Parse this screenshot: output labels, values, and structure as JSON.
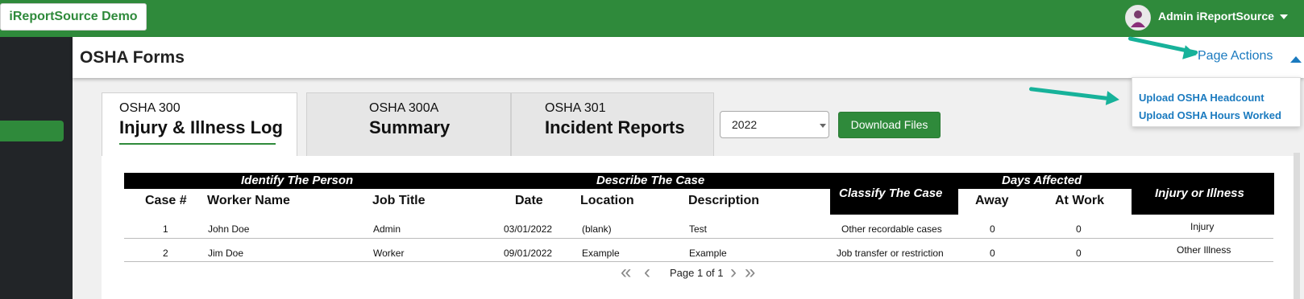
{
  "topbar": {
    "brand": "iReportSource Demo",
    "user_name": "Admin iReportSource"
  },
  "header": {
    "title": "OSHA Forms",
    "page_actions": "Page Actions"
  },
  "page_actions_menu": [
    "Upload OSHA Headcount",
    "Upload OSHA Hours Worked"
  ],
  "tabs": [
    {
      "code": "OSHA 300",
      "title": "Injury & Illness Log"
    },
    {
      "code": "OSHA 300A",
      "title": "Summary"
    },
    {
      "code": "OSHA 301",
      "title": "Incident Reports"
    }
  ],
  "year_select": {
    "value": "2022"
  },
  "download_button": "Download Files",
  "table": {
    "groups": {
      "identify": "Identify The Person",
      "describe": "Describe The Case",
      "classify": "Classify The Case",
      "days": "Days Affected",
      "injury": "Injury or Illness"
    },
    "columns": [
      "Case #",
      "Worker Name",
      "Job Title",
      "Date",
      "Location",
      "Description",
      "Away",
      "At Work"
    ],
    "rows": [
      {
        "case": "1",
        "worker": "John Doe",
        "job": "Admin",
        "date": "03/01/2022",
        "location": "(blank)",
        "description": "Test",
        "classify": "Other recordable cases",
        "away": "0",
        "atwork": "0",
        "injury": "Injury"
      },
      {
        "case": "2",
        "worker": "Jim Doe",
        "job": "Worker",
        "date": "09/01/2022",
        "location": "Example",
        "description": "Example",
        "classify": "Job transfer or restriction",
        "away": "0",
        "atwork": "0",
        "injury": "Other Illness"
      }
    ]
  },
  "pagination": {
    "info": "Page 1 of 1"
  },
  "colors": {
    "brand_green": "#2f8a3b",
    "link_blue": "#1a7abf",
    "annotation_teal": "#17b29a",
    "sidebar": "#222528"
  },
  "icons": {
    "user_caret": "caret-down-icon",
    "page_actions_caret": "caret-up-icon",
    "pager_first": "double-chevron-left-icon",
    "pager_prev": "chevron-left-icon",
    "pager_next": "chevron-right-icon",
    "pager_last": "double-chevron-right-icon"
  }
}
